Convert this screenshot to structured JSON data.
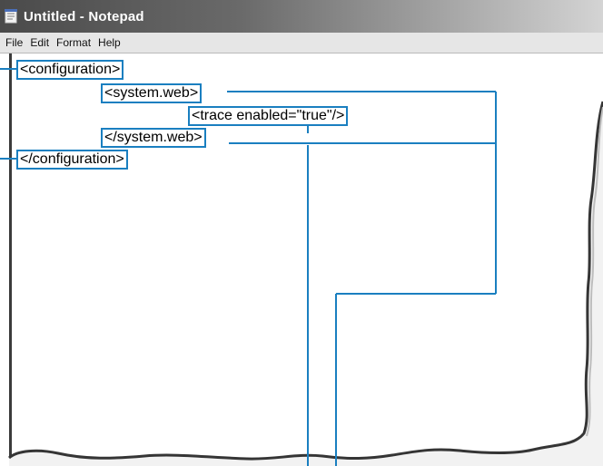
{
  "window": {
    "title": "Untitled - Notepad"
  },
  "menu": {
    "items": [
      "File",
      "Edit",
      "Format",
      "Help"
    ]
  },
  "editor": {
    "lines": [
      "<configuration>",
      "<system.web>",
      "<trace enabled=\"true\"/>",
      "</system.web>",
      "</configuration>"
    ]
  },
  "colors": {
    "highlight": "#1a7fc0",
    "title_bar": "#4a4a4a"
  },
  "icons": {
    "app": "notepad-icon"
  }
}
